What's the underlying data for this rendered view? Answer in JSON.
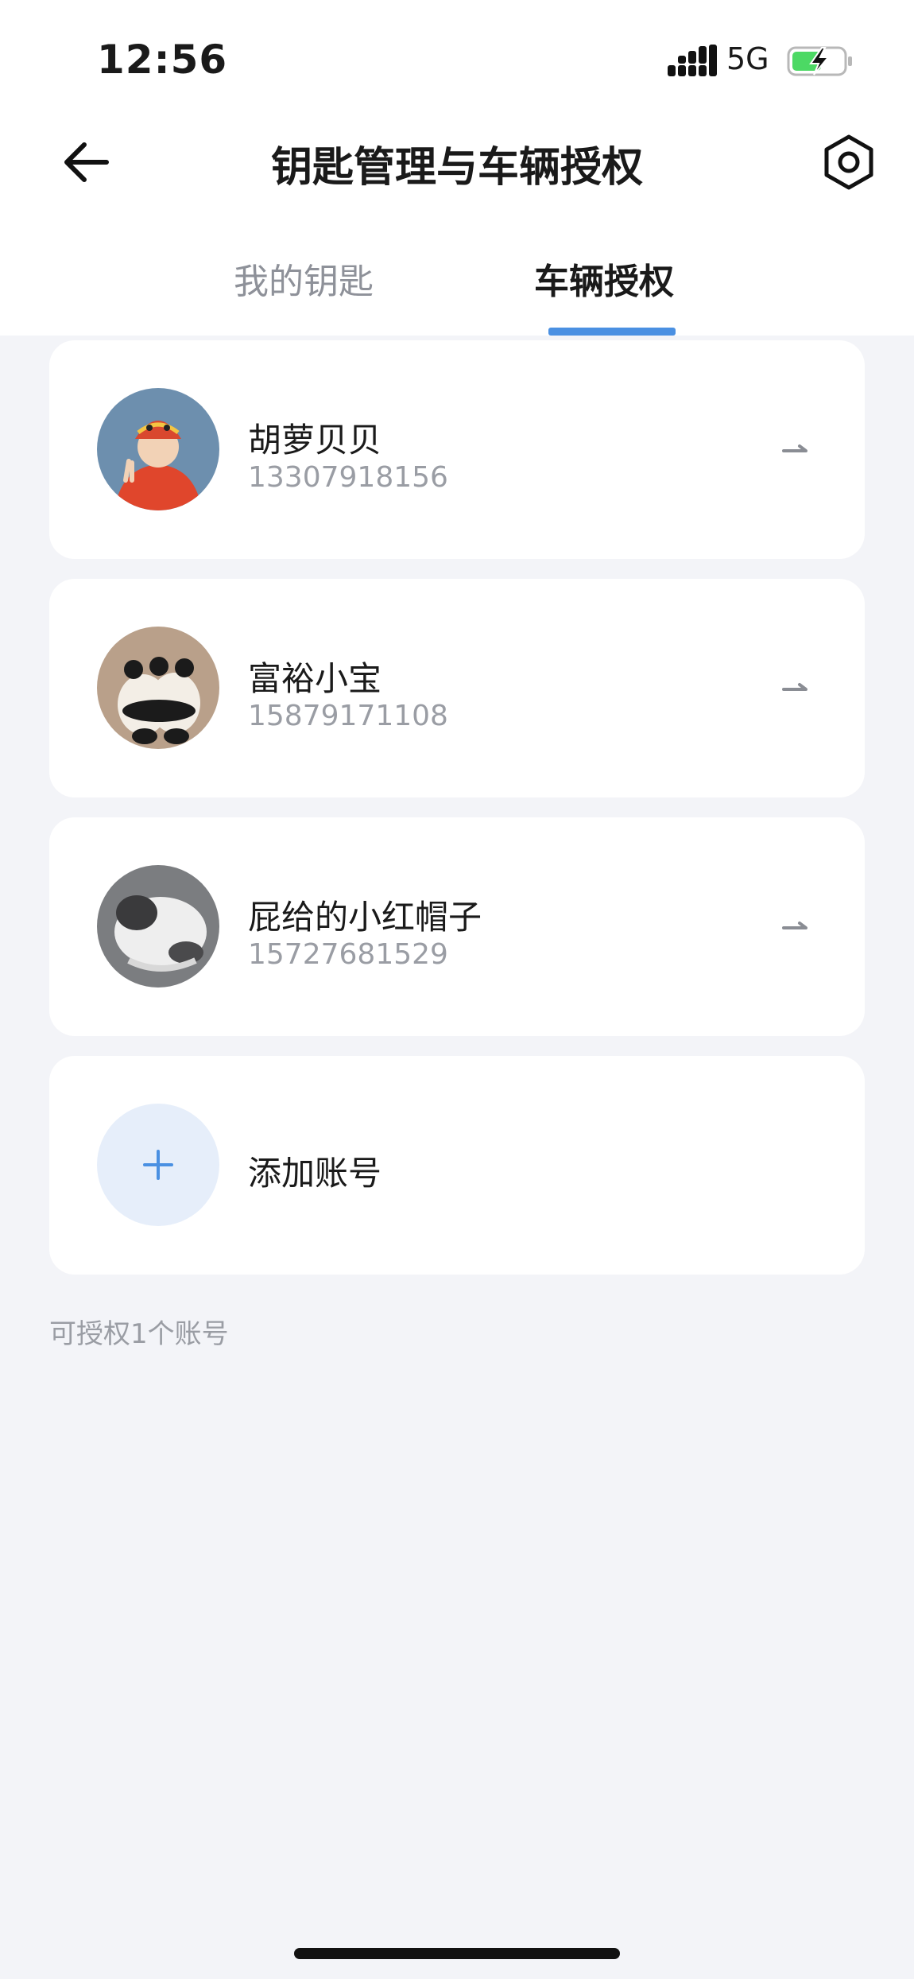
{
  "status_bar": {
    "time": "12:56",
    "network": "5G"
  },
  "header": {
    "title": "钥匙管理与车辆授权"
  },
  "tabs": [
    {
      "label": "我的钥匙",
      "active": false
    },
    {
      "label": "车辆授权",
      "active": true
    }
  ],
  "accounts": [
    {
      "name": "胡萝贝贝",
      "phone": "13307918156"
    },
    {
      "name": "富裕小宝",
      "phone": "15879171108"
    },
    {
      "name": "屁给的小红帽子",
      "phone": "15727681529"
    }
  ],
  "add_account": {
    "label": "添加账号"
  },
  "quota_note": "可授权1个账号",
  "colors": {
    "accent": "#4a90e2",
    "background": "#f3f4f8",
    "card": "#ffffff",
    "muted_text": "#9a9da4"
  }
}
